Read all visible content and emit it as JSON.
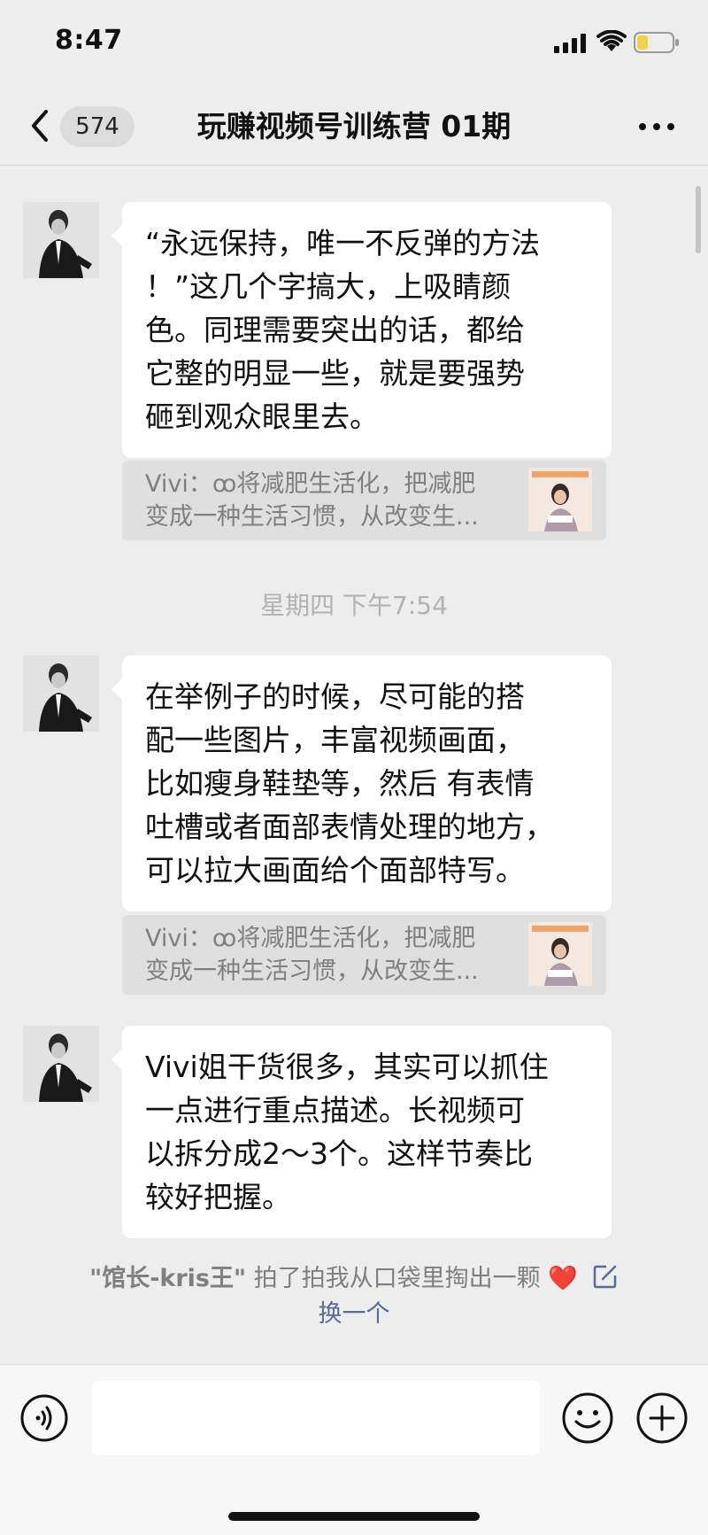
{
  "status_bar": {
    "time": "8:47"
  },
  "nav": {
    "unread_count": "574",
    "title": "玩赚视频号训练营 01期"
  },
  "messages": [
    {
      "lines": [
        "“永远保持，唯一不反弹的方法",
        "！”这几个字搞大，上吸睛颜",
        "色。同理需要突出的话，都给",
        "它整的明显一些，就是要强势",
        "砸到观众眼里去。"
      ],
      "quote": {
        "line1": "Vivi：ꝏ将减肥生活化，把减肥",
        "line2": "变成一种生活习惯，从改变生..."
      }
    },
    {
      "lines": [
        "在举例子的时候，尽可能的搭",
        "配一些图片，丰富视频画面，",
        "比如瘦身鞋垫等，然后 有表情",
        "吐槽或者面部表情处理的地方，",
        "可以拉大画面给个面部特写。"
      ],
      "quote": {
        "line1": "Vivi：ꝏ将减肥生活化，把减肥",
        "line2": "变成一种生活习惯，从改变生..."
      }
    },
    {
      "lines": [
        "Vivi姐干货很多，其实可以抓住",
        "一点进行重点描述。长视频可",
        "以拆分成2～3个。这样节奏比",
        "较好把握。"
      ]
    }
  ],
  "timestamp": "星期四 下午7:54",
  "pat_notice": {
    "name": "\"馆长-kris王\"",
    "text": " 拍了拍我从口袋里掏出一颗 ",
    "heart": "❤️",
    "change_label": "换一个"
  },
  "colors": {
    "background": "#ededed",
    "bubble": "#ffffff",
    "link": "#576b95",
    "heart": "#e0243a"
  },
  "icons": [
    "signal-icon",
    "wifi-icon",
    "battery-icon",
    "back-chevron-icon",
    "more-icon",
    "voice-icon",
    "emoji-icon",
    "plus-icon",
    "edit-icon"
  ]
}
